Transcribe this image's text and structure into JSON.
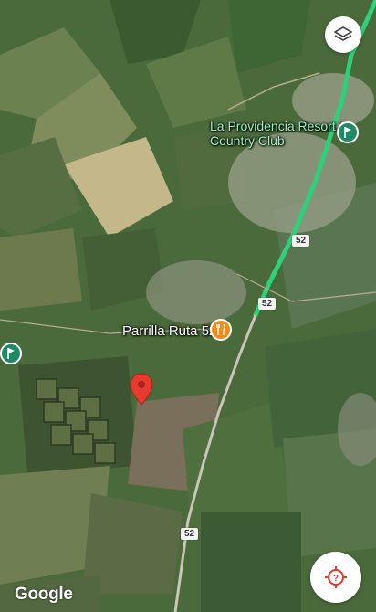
{
  "map": {
    "labels": {
      "resort": "La Providencia Resort & Country Club",
      "restaurant": "Parrilla Ruta 52"
    },
    "route_shields": [
      "52",
      "52",
      "52"
    ],
    "attribution": "Google",
    "colors": {
      "highway": "#2fd07a",
      "road": "#c9c5b8",
      "pin": "#e63b2e",
      "poi_green": "#1e8a63",
      "poi_orange": "#f28b1b",
      "accent": "#e53935"
    }
  },
  "controls": {
    "layers_icon": "layers-icon",
    "locate_icon": "locate-target-icon"
  },
  "pois": [
    {
      "name": "resort-poi",
      "icon": "golf-flag-icon"
    },
    {
      "name": "restaurant-poi",
      "icon": "fork-knife-icon"
    },
    {
      "name": "golf-poi",
      "icon": "golf-flag-icon"
    }
  ],
  "marker": {
    "icon": "map-pin-icon"
  }
}
